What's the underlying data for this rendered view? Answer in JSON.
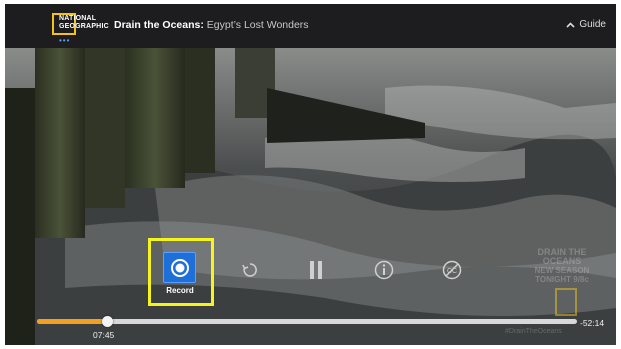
{
  "header": {
    "logo_line1": "NATIONAL",
    "logo_line2": "GEOGRAPHIC",
    "logo_dots": "•••",
    "show_title": "Drain the Oceans:",
    "episode_title": "Egypt’s Lost Wonders",
    "guide_label": "Guide",
    "guide_icon": "chevron-up-icon"
  },
  "player": {
    "record_label": "Record",
    "buttons": [
      "record",
      "restart",
      "pause",
      "info",
      "closed-captions-off"
    ],
    "current_time": "07:45",
    "remaining_time": "-52:14",
    "progress": 0.13
  },
  "promo": {
    "title_line1": "DRAIN THE",
    "title_line2": "OCEANS",
    "line3": "NEW SEASON",
    "line4": "TONIGHT 9/8c",
    "hashtag": "#DrainTheOceans"
  },
  "colors": {
    "accent_orange": "#f1a023",
    "highlight_yellow": "#f6f41d",
    "record_blue": "#1e6fd8",
    "logo_yellow": "#f2c31b"
  }
}
